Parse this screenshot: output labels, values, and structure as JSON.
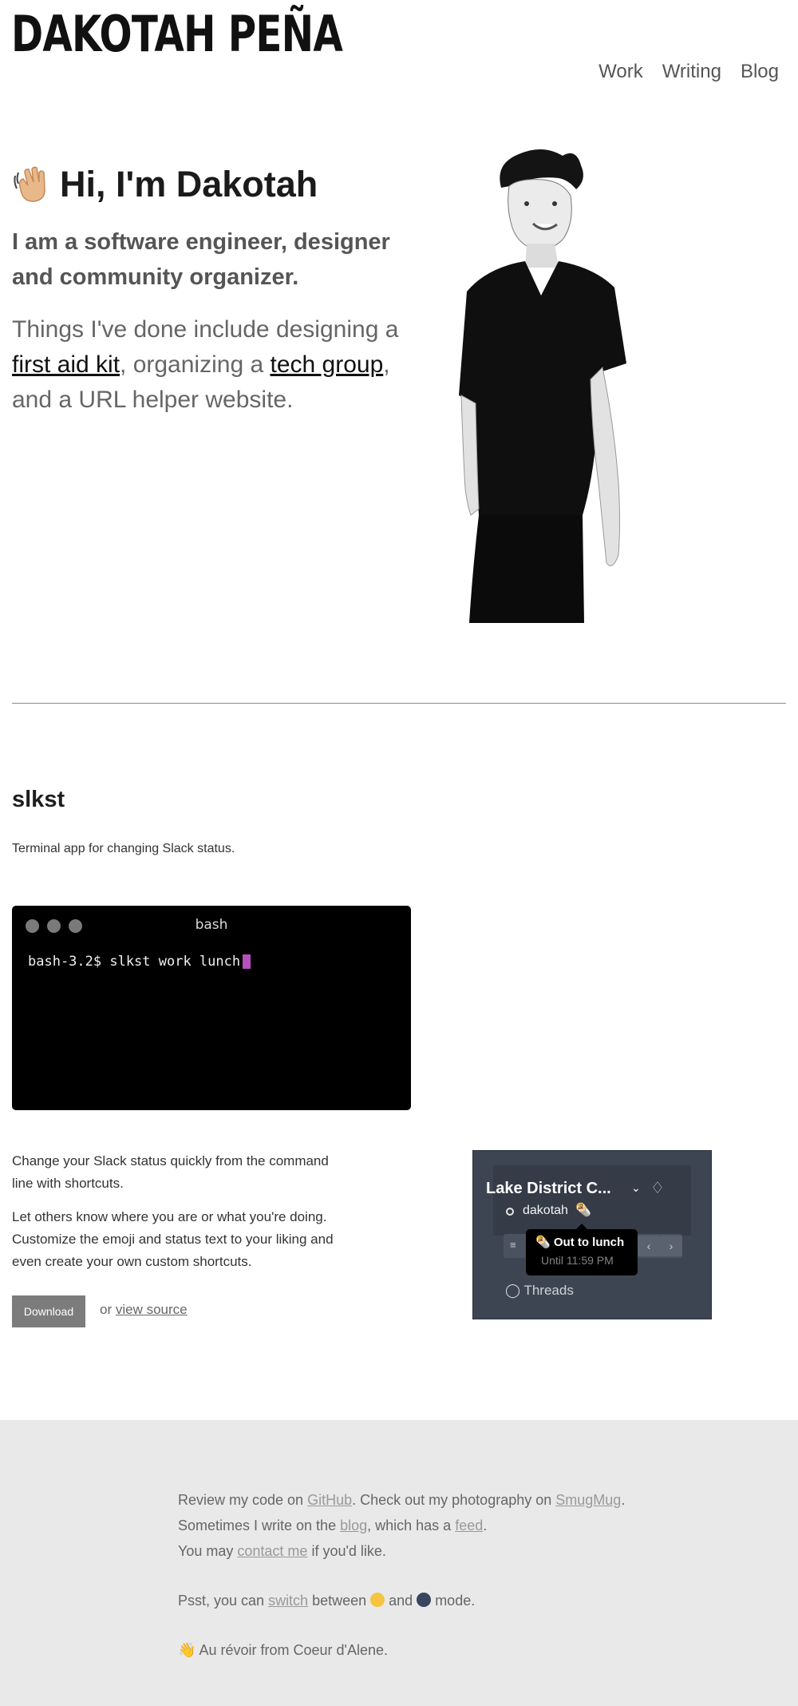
{
  "header": {
    "site_title": "DAKOTAH PEÑA",
    "nav": [
      "Work",
      "Writing",
      "Blog"
    ]
  },
  "hero": {
    "greeting": "Hi, I'm Dakotah",
    "tagline": "I am a software engineer, designer and community organizer.",
    "done_intro": "Things I've done include designing a ",
    "link_first_aid": "first aid kit",
    "done_mid": ", organizing a ",
    "link_tech_group": "tech group",
    "done_end": ", and a URL helper website."
  },
  "project": {
    "title": "slkst",
    "subtitle": "Terminal app for changing Slack status.",
    "terminal": {
      "title": "bash",
      "prompt": "bash-3.2$ slkst work lunch"
    },
    "desc1": "Change your Slack status quickly from the command line with shortcuts.",
    "desc2": "Let others know where you are or what you're doing. Customize the emoji and status text to your liking and even create your own custom shortcuts.",
    "download_label": "Download",
    "or_text": "or ",
    "view_source": "view source",
    "slack": {
      "workspace": "Lake District C...",
      "username": "dakotah",
      "tooltip_title": "Out to lunch",
      "tooltip_sub": "Until 11:59 PM",
      "threads": "Threads"
    }
  },
  "footer": {
    "l1_a": "Review my code on ",
    "github": "GitHub",
    "l1_b": ". Check out my photography on ",
    "smugmug": "SmugMug",
    "l1_c": ".",
    "l2_a": "Sometimes I write on the ",
    "blog": "blog",
    "l2_b": ", which has a ",
    "feed": "feed",
    "l2_c": ".",
    "l3_a": "You may ",
    "contact": "contact me",
    "l3_b": " if you'd like.",
    "psst_a": "Psst, you can ",
    "switch": "switch",
    "psst_b": " between ",
    "psst_c": " and ",
    "psst_d": " mode.",
    "farewell": "Au révoir from Coeur d'Alene."
  },
  "colors": {
    "terminal_bg": "#000000",
    "cursor": "#b84fc0",
    "slack_bg": "#3e4552",
    "footer_bg": "#e9e9e9",
    "button_bg": "#7c7c7c"
  }
}
